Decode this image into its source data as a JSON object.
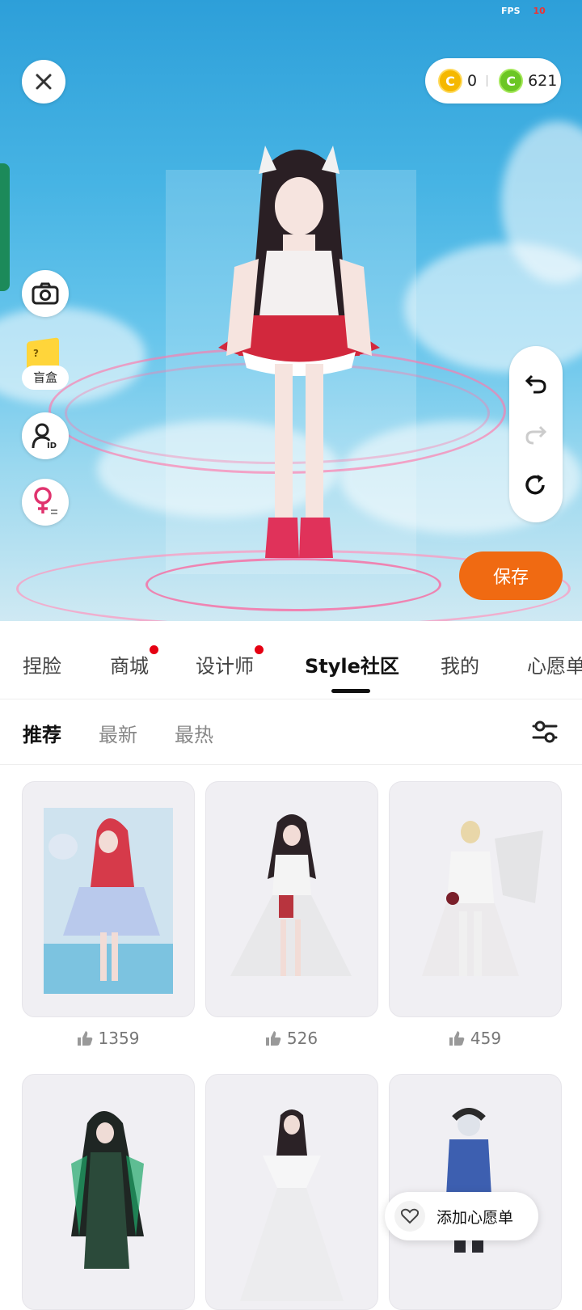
{
  "status": {
    "fps_label": "FPS",
    "fps_value": "10"
  },
  "currency": {
    "gold_amount": "0",
    "green_amount": "621"
  },
  "side_buttons": {
    "blind_box_label": "盲盒"
  },
  "actions": {
    "save_label": "保存"
  },
  "tabs": [
    {
      "label": "捏脸",
      "dot": false
    },
    {
      "label": "商城",
      "dot": true
    },
    {
      "label": "设计师",
      "dot": true
    },
    {
      "label": "Style社区",
      "dot": false,
      "active": true
    },
    {
      "label": "我的",
      "dot": false
    },
    {
      "label": "心愿单",
      "dot": false
    }
  ],
  "subtabs": [
    {
      "label": "推荐",
      "active": true
    },
    {
      "label": "最新",
      "active": false
    },
    {
      "label": "最热",
      "active": false
    }
  ],
  "outfits": [
    {
      "likes": "1359",
      "theme": "mermaid-blue"
    },
    {
      "likes": "526",
      "theme": "white-dress-dark-hair"
    },
    {
      "likes": "459",
      "theme": "white-angel"
    },
    {
      "likes": "",
      "theme": "green-dark"
    },
    {
      "likes": "",
      "theme": "white-gown"
    },
    {
      "likes": "",
      "theme": "blue-hoodie"
    }
  ],
  "wishlist": {
    "label": "添加心愿单"
  },
  "colors": {
    "accent_orange": "#f06a12",
    "dot_red": "#e50012",
    "sky": "#47b4e4"
  }
}
